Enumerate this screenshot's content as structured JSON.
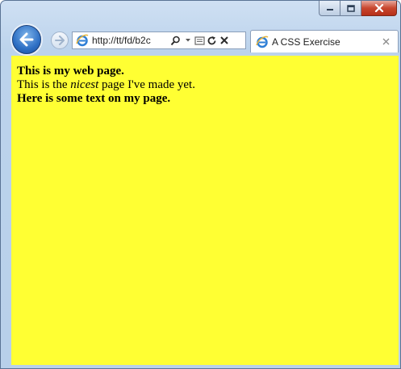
{
  "browser": {
    "address_url": "http://tt/fd/b2c",
    "tab_title": "A CSS Exercise"
  },
  "page": {
    "line1": "This is my web page.",
    "line2_prefix": "This is the ",
    "line2_em": "nicest",
    "line2_suffix": " page I've made yet.",
    "line3": "Here is some text on my page.",
    "background_color": "#ffff33"
  },
  "icons": {
    "back": "back-arrow-icon",
    "forward": "forward-arrow-icon",
    "favicon": "ie-logo-icon",
    "search": "search-icon",
    "dropdown": "chevron-down-icon",
    "compat": "compatibility-view-icon",
    "refresh": "refresh-icon",
    "stop": "stop-icon",
    "tab_close": "close-icon"
  }
}
